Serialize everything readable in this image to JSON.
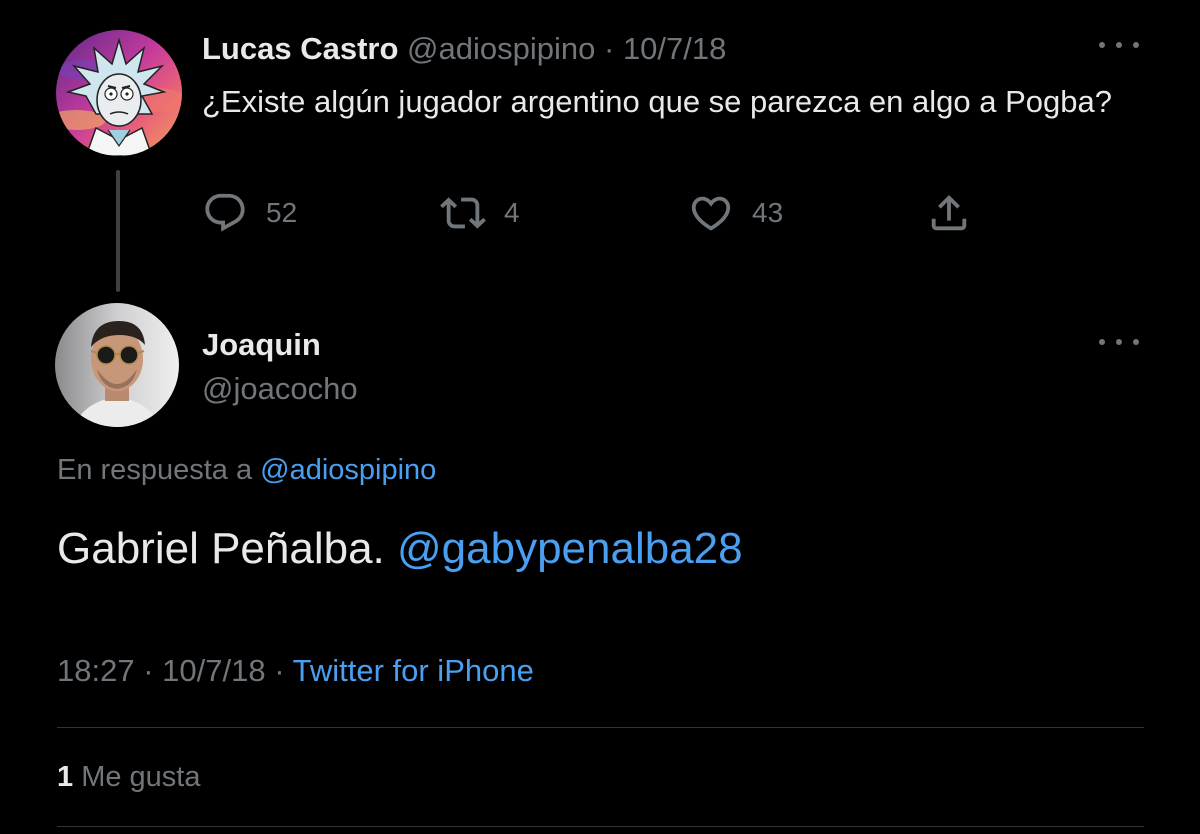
{
  "parent_tweet": {
    "avatar": "cartoon-avatar",
    "name": "Lucas Castro",
    "handle": "@adiospipino",
    "separator": "·",
    "date": "10/7/18",
    "text": "¿Existe algún jugador argentino que se parezca en algo a Pogba?",
    "actions": {
      "reply": {
        "icon": "reply-icon",
        "count": "52"
      },
      "retweet": {
        "icon": "retweet-icon",
        "count": "4"
      },
      "like": {
        "icon": "heart-icon",
        "count": "43"
      },
      "share": {
        "icon": "share-icon"
      }
    }
  },
  "reply_tweet": {
    "avatar": "photo-avatar",
    "name": "Joaquin",
    "handle": "@joacocho",
    "replying_to_label": "En respuesta a",
    "replying_to_handle": "@adiospipino",
    "text": "Gabriel Peñalba.",
    "mention": "@gabypenalba28",
    "time": "18:27",
    "dot": "·",
    "date": "10/7/18",
    "source": "Twitter for iPhone",
    "likes_count": "1",
    "likes_label": "Me gusta"
  },
  "colors": {
    "background": "#000000",
    "text": "#e7e9ea",
    "secondary": "#71767b",
    "link": "#4a9ff0",
    "divider": "#2f3336"
  }
}
